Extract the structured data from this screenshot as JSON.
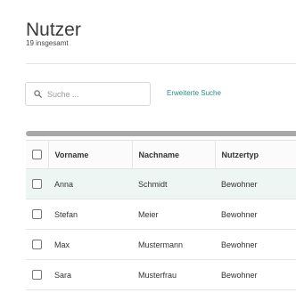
{
  "header": {
    "title": "Nutzer",
    "total_count": "19 insgesamt"
  },
  "search": {
    "placeholder": "Suche ...",
    "value": "",
    "advanced_link": "Erweiterte Suche"
  },
  "table": {
    "columns": [
      "Vorname",
      "Nachname",
      "Nutzertyp"
    ],
    "rows": [
      {
        "vorname": "Anna",
        "nachname": "Schmidt",
        "nutzertyp": "Bewohner",
        "highlighted": true
      },
      {
        "vorname": "Stefan",
        "nachname": "Meier",
        "nutzertyp": "Bewohner",
        "highlighted": false
      },
      {
        "vorname": "Max",
        "nachname": "Mustermann",
        "nutzertyp": "Bewohner",
        "highlighted": false
      },
      {
        "vorname": "Sara",
        "nachname": "Musterfrau",
        "nutzertyp": "Bewohner",
        "highlighted": false
      }
    ]
  },
  "icons": {
    "search": "search-icon"
  },
  "colors": {
    "accent_link": "#2b8a8a",
    "row_highlight": "#eef6f4",
    "scrollbar": "#a9a9a9"
  }
}
